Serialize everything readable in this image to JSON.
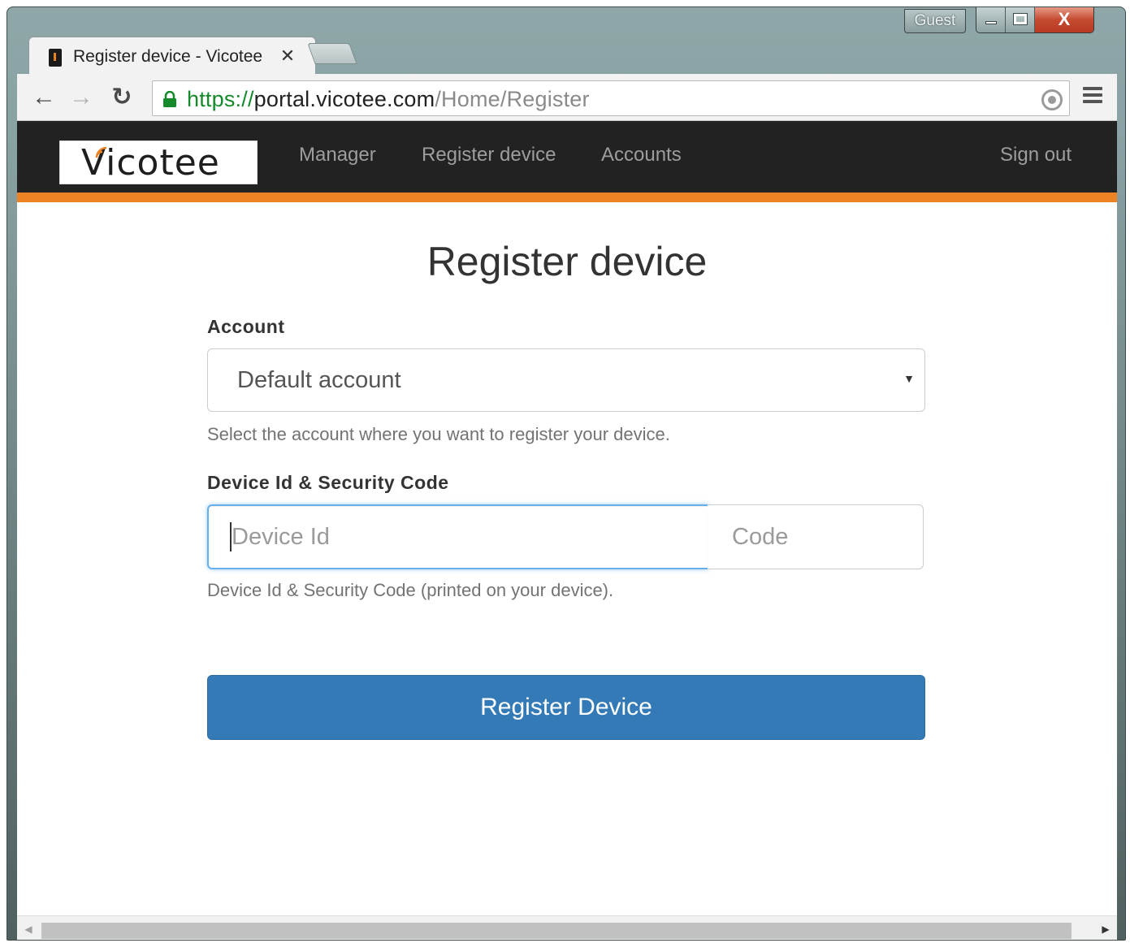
{
  "window": {
    "guest_label": "Guest",
    "close_glyph": "X"
  },
  "tab": {
    "title": "Register device - Vicotee",
    "close_glyph": "✕"
  },
  "toolbar": {
    "back_glyph": "←",
    "forward_glyph": "→",
    "reload_glyph": "↻",
    "url_scheme": "https://",
    "url_host": "portal.vicotee.com",
    "url_path": "/Home/Register"
  },
  "navbar": {
    "brand": "Vicotee",
    "links": [
      {
        "label": "Manager"
      },
      {
        "label": "Register device"
      },
      {
        "label": "Accounts"
      }
    ],
    "sign_out": "Sign out",
    "accent_color": "#ec8425"
  },
  "page": {
    "title": "Register device",
    "account_label": "Account",
    "account_selected": "Default account",
    "account_help": "Select the account where you want to register your device.",
    "device_label": "Device Id & Security Code",
    "device_placeholder": "Device Id",
    "code_placeholder": "Code",
    "device_help": "Device Id & Security Code (printed on your device).",
    "submit_label": "Register Device",
    "submit_color": "#337ab7"
  },
  "scrollbar": {
    "left_glyph": "◀",
    "right_glyph": "▶"
  }
}
